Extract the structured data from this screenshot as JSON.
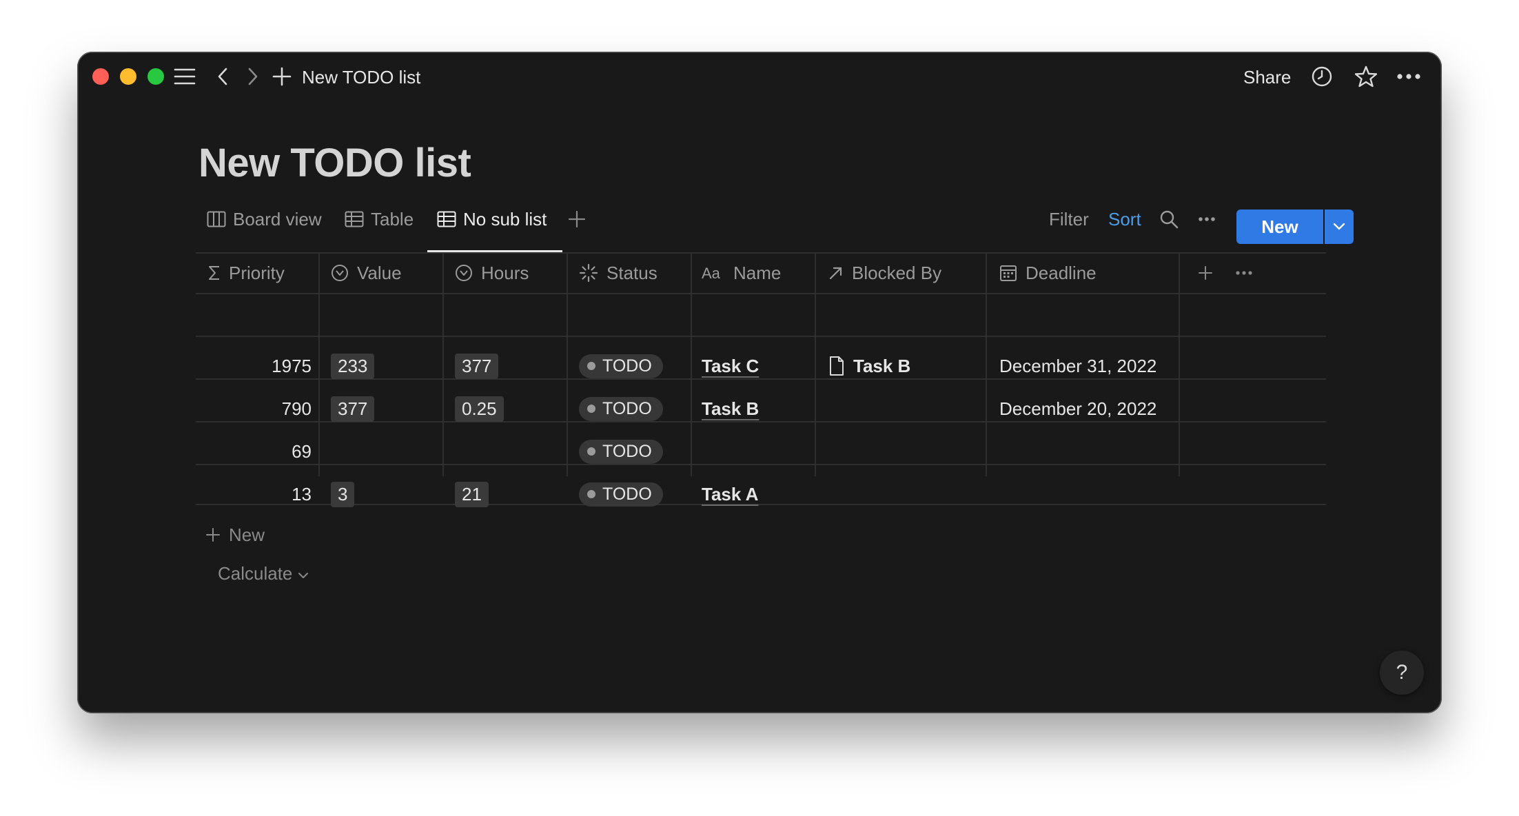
{
  "window": {
    "breadcrumb": "New TODO list",
    "share_label": "Share"
  },
  "page": {
    "title": "New TODO list"
  },
  "views": [
    {
      "label": "Board view",
      "icon": "board-icon",
      "active": false
    },
    {
      "label": "Table",
      "icon": "table-icon",
      "active": false
    },
    {
      "label": "No sub list",
      "icon": "table-icon",
      "active": true
    }
  ],
  "toolbar": {
    "filter_label": "Filter",
    "sort_label": "Sort",
    "new_label": "New",
    "sort_color": "#4b9dea",
    "new_color": "#2f7ae5"
  },
  "table": {
    "columns": [
      {
        "label": "Priority",
        "icon": "sigma-icon"
      },
      {
        "label": "Value",
        "icon": "formula-icon"
      },
      {
        "label": "Hours",
        "icon": "formula-icon"
      },
      {
        "label": "Status",
        "icon": "status-spinner-icon"
      },
      {
        "label": "Name",
        "icon": "text-aa-icon"
      },
      {
        "label": "Blocked By",
        "icon": "relation-arrow-icon"
      },
      {
        "label": "Deadline",
        "icon": "calendar-icon"
      }
    ],
    "rows": [
      {
        "priority": "1975",
        "value": "233",
        "hours": "377",
        "status": "TODO",
        "name": "Task C",
        "blocked_by": "Task B",
        "deadline": "December 31, 2022"
      },
      {
        "priority": "790",
        "value": "377",
        "hours": "0.25",
        "status": "TODO",
        "name": "Task B",
        "blocked_by": "",
        "deadline": "December 20, 2022"
      },
      {
        "priority": "69",
        "value": "",
        "hours": "",
        "status": "TODO",
        "name": "",
        "blocked_by": "",
        "deadline": ""
      },
      {
        "priority": "13",
        "value": "3",
        "hours": "21",
        "status": "TODO",
        "name": "Task A",
        "blocked_by": "",
        "deadline": ""
      }
    ],
    "new_row_label": "New",
    "calculate_label": "Calculate"
  },
  "help_label": "?"
}
